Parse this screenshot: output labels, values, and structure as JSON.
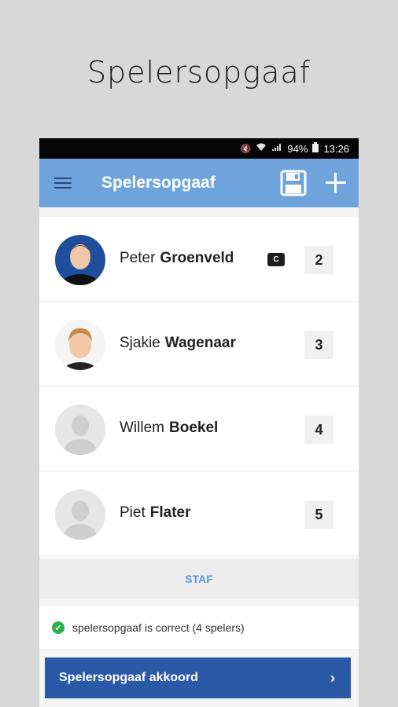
{
  "hero": {
    "title": "Spelersopgaaf"
  },
  "status_bar": {
    "battery": "94%",
    "time": "13:26"
  },
  "app_bar": {
    "title": "Spelersopgaaf"
  },
  "players": [
    {
      "first": "Peter",
      "last": "Groenveld",
      "number": "2",
      "captain": "C",
      "avatar": "photo-man"
    },
    {
      "first": "Sjakie",
      "last": "Wagenaar",
      "number": "3",
      "avatar": "photo-boy"
    },
    {
      "first": "Willem",
      "last": "Boekel",
      "number": "4",
      "avatar": "placeholder"
    },
    {
      "first": "Piet",
      "last": "Flater",
      "number": "5",
      "avatar": "placeholder"
    }
  ],
  "staff": {
    "label": "STAF"
  },
  "validation": {
    "text": "spelersopgaaf is correct (4 spelers)"
  },
  "confirm": {
    "label": "Spelersopgaaf akkoord",
    "chevron": "›"
  },
  "colors": {
    "app_bar": "#6fa3dc",
    "confirm_button": "#2b58a7",
    "staff_text": "#5a97dc",
    "check": "#2bb04a"
  }
}
